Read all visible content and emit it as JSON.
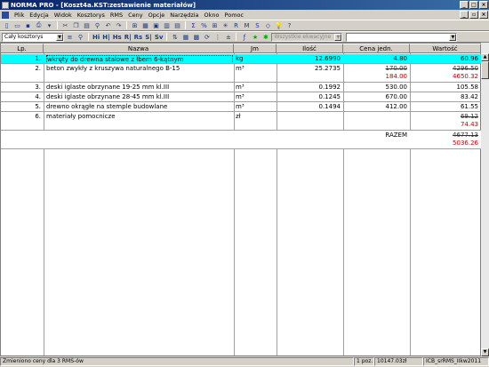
{
  "window": {
    "title": "NORMA PRO - [Koszt4a.KST:zestawienie materiałów]"
  },
  "menu": [
    "Plik",
    "Edycja",
    "Widok",
    "Kosztorys",
    "RMS",
    "Ceny",
    "Opcje",
    "Narzędzia",
    "Okno",
    "Pomoc"
  ],
  "toolbar2": {
    "scope_combo": "Cały kosztorys",
    "filter_combo": "Wszystkie ekwacyjne",
    "tool_labels": [
      "Hi",
      "H|",
      "Hs",
      "R|",
      "Rs",
      "S|",
      "Sv"
    ]
  },
  "table": {
    "headers": {
      "lp": "Lp.",
      "nazwa": "Nazwa",
      "jm": "Jm",
      "ilosc": "Ilość",
      "cena": "Cena jedn.",
      "wartosc": "Wartość"
    },
    "rows": [
      {
        "lp": "1.",
        "nazwa": "wkręty do drewna stalowe z łbem 6-kątnym",
        "jm": "kg",
        "ilosc": "12.6990",
        "cena": "4.80",
        "cena2": "",
        "wartosc": "60.96",
        "wartosc2": ""
      },
      {
        "lp": "2.",
        "nazwa": "beton zwykły z kruszywa naturalnego B-15",
        "jm": "m³",
        "ilosc": "25.2735",
        "cena": "170.00",
        "cena2": "184.00",
        "wartosc": "4296.50",
        "wartosc2": "4650.32"
      },
      {
        "lp": "3.",
        "nazwa": "deski iglaste obrzynane 19-25 mm kl.III",
        "jm": "m³",
        "ilosc": "0.1992",
        "cena": "530.00",
        "cena2": "",
        "wartosc": "105.58",
        "wartosc2": ""
      },
      {
        "lp": "4.",
        "nazwa": "deski iglaste obrzynane 28-45 mm kl.III",
        "jm": "m³",
        "ilosc": "0.1245",
        "cena": "670.00",
        "cena2": "",
        "wartosc": "83.42",
        "wartosc2": ""
      },
      {
        "lp": "5.",
        "nazwa": "drewno okrągłe na stemple budowlane",
        "jm": "m³",
        "ilosc": "0.1494",
        "cena": "412.00",
        "cena2": "",
        "wartosc": "61.55",
        "wartosc2": ""
      },
      {
        "lp": "6.",
        "nazwa": "materiały pomocnicze",
        "jm": "zł",
        "ilosc": "",
        "cena": "",
        "cena2": "",
        "wartosc": "69.12",
        "wartosc2": "74.43"
      }
    ],
    "total": {
      "label": "RAZEM",
      "old": "4677.13",
      "new": "5036.26"
    }
  },
  "status": {
    "message": "Zmieniono ceny dla 3 RMS-ów",
    "pos": "1 poz.",
    "sum": "10147.03zł",
    "base": "ICB_srRMS_IIkw2011"
  }
}
